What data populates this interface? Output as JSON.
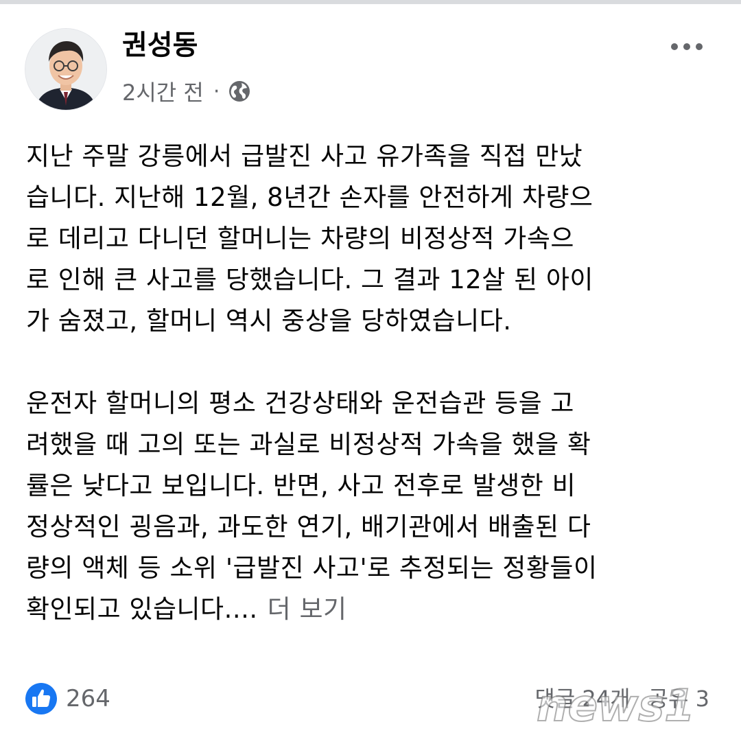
{
  "post": {
    "author": "권성동",
    "timestamp": "2시간 전",
    "separator": "·",
    "privacy_icon": "globe-icon",
    "more_icon": "more-horizontal-icon",
    "body_paragraph_1": [
      "지난 주말 강릉에서 급발진 사고 유가족을 직접 만났",
      "습니다. 지난해 12월, 8년간 손자를 안전하게 차량으",
      "로 데리고 다니던 할머니는 차량의 비정상적 가속으",
      "로 인해 큰 사고를 당했습니다. 그 결과 12살 된 아이",
      "가 숨졌고, 할머니 역시 중상을 당하였습니다."
    ],
    "body_paragraph_2": [
      "운전자 할머니의 평소 건강상태와 운전습관 등을 고",
      "려했을 때 고의 또는 과실로 비정상적 가속을 했을 확",
      "률은 낮다고 보입니다. 반면, 사고 전후로 발생한 비",
      "정상적인 굉음과, 과도한 연기, 배기관에서 배출된 다",
      "량의 액체 등 소위 '급발진 사고'로 추정되는 정황들이",
      "확인되고 있습니다...."
    ],
    "see_more": "더 보기"
  },
  "footer": {
    "like_icon": "like-thumb-icon",
    "like_count": "264",
    "comments": "댓글 24개",
    "shares": "공유 3"
  },
  "watermark": {
    "text": "news1"
  },
  "colors": {
    "text_primary": "#050505",
    "text_secondary": "#65676b",
    "like_blue": "#1877f2"
  }
}
